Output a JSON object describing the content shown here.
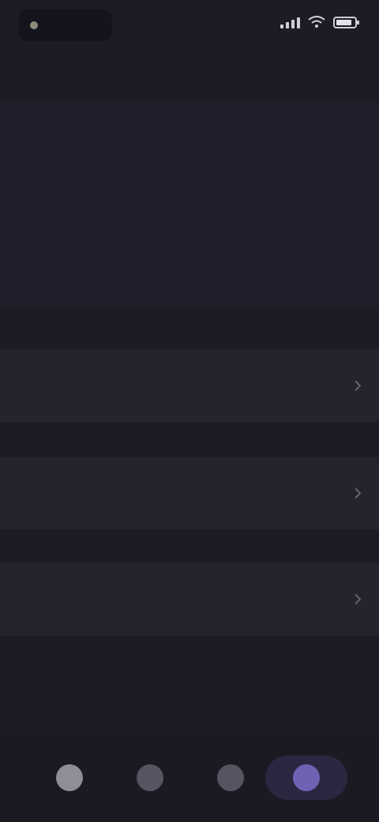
{
  "status_bar": {
    "time": "",
    "icons": [
      "signal-icon",
      "wifi-icon",
      "battery-icon"
    ]
  },
  "header": {
    "title": ""
  },
  "info_card": {
    "heading": "",
    "rows": [
      {
        "label": "",
        "value": ""
      },
      {
        "label": "",
        "value": ""
      }
    ],
    "link_label": ""
  },
  "list_items": [
    {
      "label": ""
    },
    {
      "label": ""
    },
    {
      "label": ""
    }
  ],
  "danger_action": {
    "label": ""
  },
  "bottom_nav": {
    "items": [
      {
        "icon": "home-icon",
        "active": false
      },
      {
        "icon": "search-icon",
        "active": false
      },
      {
        "icon": "chat-icon",
        "active": false
      },
      {
        "icon": "profile-icon",
        "active": true
      }
    ]
  },
  "colors": {
    "background": "#1c1c27",
    "card": "#24242f",
    "accent": "#7a6ad6",
    "danger": "#a4525f"
  }
}
